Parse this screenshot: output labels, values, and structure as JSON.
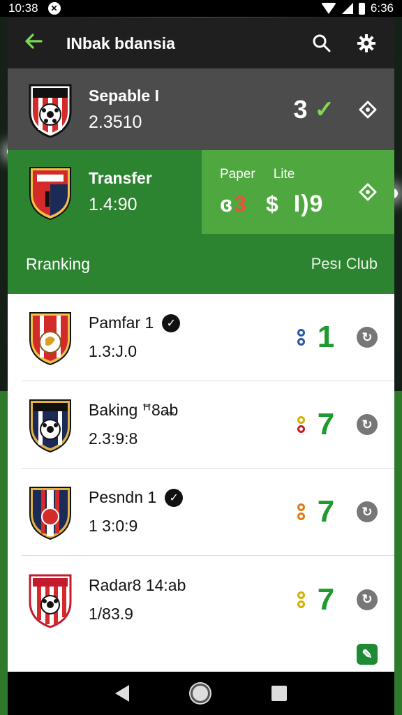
{
  "status_bar": {
    "time_left": "10:38",
    "time_right": "6:36"
  },
  "app_bar": {
    "title": "INbak bdansia"
  },
  "top_match": {
    "name": "Sepable I",
    "value": "2.3510",
    "score": "3"
  },
  "transfer": {
    "name": "Transfer",
    "value": "1.4:90",
    "label_1": "Paper",
    "label_2": "Lite",
    "v1": "ɞ",
    "v2": "3",
    "v3": "$",
    "v4": "I)9"
  },
  "section": {
    "left": "Rranking",
    "right": "Pesı Club"
  },
  "rankings": [
    {
      "name": "Pamfar 1",
      "value": "1.3:J.0",
      "number": "1",
      "verified": true,
      "pin_colors": [
        "#2a56a8",
        "#2a56a8"
      ]
    },
    {
      "name": "Baking ꟸ8a̶b",
      "value": "2.3:9:8",
      "number": "7",
      "verified": false,
      "pin_colors": [
        "#d4b000",
        "#c21b2e"
      ]
    },
    {
      "name": "Pesndn 1",
      "value": "1 3:0:9",
      "number": "7",
      "verified": true,
      "pin_colors": [
        "#e07a10",
        "#e07a10"
      ]
    },
    {
      "name": "Radar8 14:ab",
      "value": "1/83.9",
      "number": "7",
      "verified": false,
      "pin_colors": [
        "#d4b000",
        "#d4b000"
      ]
    }
  ],
  "colors": {
    "accent_green": "#2c8430",
    "light_green": "#4fa83f",
    "rank_green": "#1e9a2e",
    "dark_bar": "#1f1f1f"
  },
  "icons": {
    "back": "arrow-left-icon",
    "search": "search-icon",
    "settings": "gear-icon",
    "pin": "location-pin-icon",
    "refresh": "refresh-icon"
  }
}
